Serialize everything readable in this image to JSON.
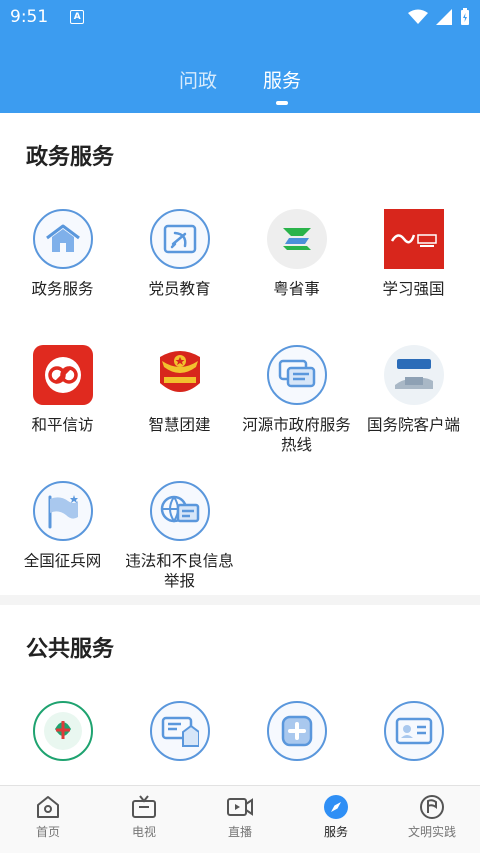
{
  "status": {
    "time": "9:51"
  },
  "tabs": [
    {
      "label": "问政"
    },
    {
      "label": "服务"
    }
  ],
  "gov": {
    "title": "政务服务",
    "items": [
      {
        "label": "政务服务",
        "icon": "house-icon"
      },
      {
        "label": "党员教育",
        "icon": "party-emblem-icon"
      },
      {
        "label": "粤省事",
        "icon": "yueshengshi-logo-icon"
      },
      {
        "label": "学习强国",
        "icon": "xuexi-qiangguo-logo-icon"
      },
      {
        "label": "和平信访",
        "icon": "heping-xinfang-logo-icon"
      },
      {
        "label": "智慧团建",
        "icon": "youth-league-emblem-icon"
      },
      {
        "label": "河源市政府服务热线",
        "icon": "chat-bubbles-icon"
      },
      {
        "label": "国务院客户端",
        "icon": "state-council-logo-icon"
      },
      {
        "label": "全国征兵网",
        "icon": "flag-icon"
      },
      {
        "label": "违法和不良信息举报",
        "icon": "globe-report-icon"
      }
    ]
  },
  "public": {
    "title": "公共服务",
    "items": [
      {
        "icon": "hospital-logo-icon"
      },
      {
        "icon": "payment-document-icon"
      },
      {
        "icon": "medical-cross-icon"
      },
      {
        "icon": "id-card-icon"
      }
    ]
  },
  "nav": [
    {
      "label": "首页",
      "icon": "home-icon"
    },
    {
      "label": "电视",
      "icon": "tv-icon"
    },
    {
      "label": "直播",
      "icon": "video-camera-icon"
    },
    {
      "label": "服务",
      "icon": "compass-icon"
    },
    {
      "label": "文明实践",
      "icon": "flag-circle-icon"
    }
  ],
  "colors": {
    "header": "#3c9cf0",
    "icon_outline": "#5a97dc",
    "accent_blue": "#2f8ff5"
  }
}
